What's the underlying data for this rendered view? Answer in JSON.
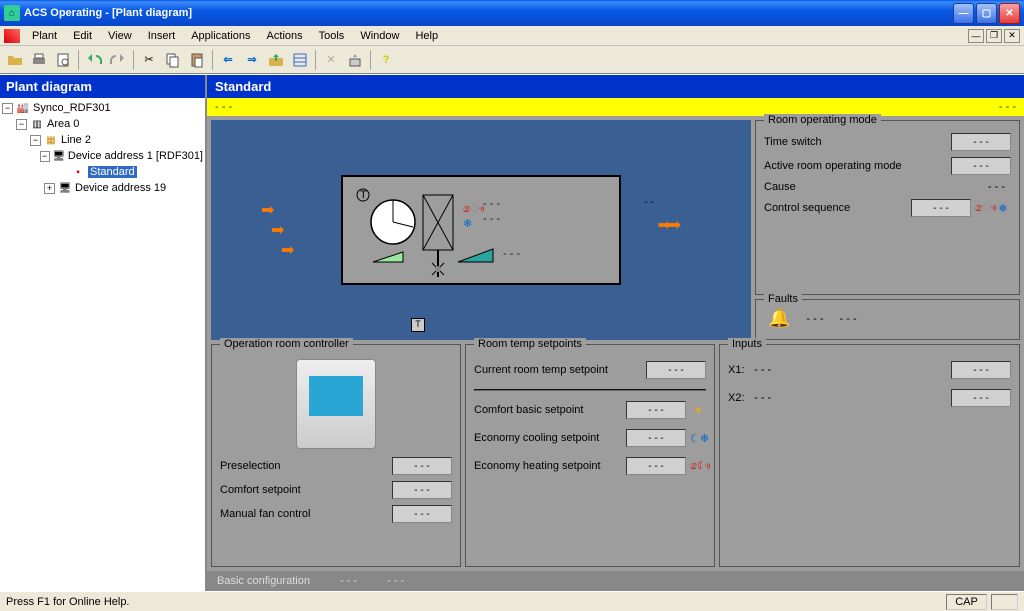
{
  "window": {
    "title": "ACS Operating - [Plant diagram]"
  },
  "menu": {
    "items": [
      "Plant",
      "Edit",
      "View",
      "Insert",
      "Applications",
      "Actions",
      "Tools",
      "Window",
      "Help"
    ]
  },
  "sidebar": {
    "title": "Plant diagram"
  },
  "tree": {
    "root": "Synco_RDF301",
    "area": "Area 0",
    "line": "Line 2",
    "dev1": "Device address 1 [RDF301]",
    "standard": "Standard",
    "dev19": "Device address 19"
  },
  "main": {
    "title": "Standard",
    "yellow_left": "- - -",
    "yellow_right": "- - -"
  },
  "room_mode": {
    "legend": "Room operating mode",
    "time_switch_label": "Time switch",
    "time_switch_val": "- - -",
    "active_label": "Active room operating mode",
    "active_val": "- - -",
    "cause_label": "Cause",
    "cause_val": "- - -",
    "ctrlseq_label": "Control sequence",
    "ctrlseq_val": "- - -"
  },
  "faults": {
    "legend": "Faults",
    "v1": "- - -",
    "v2": "- - -"
  },
  "orc": {
    "legend": "Operation room controller",
    "presel_label": "Preselection",
    "presel_val": "- - -",
    "comfort_label": "Comfort setpoint",
    "comfort_val": "- - -",
    "fan_label": "Manual fan control",
    "fan_val": "- - -"
  },
  "sp": {
    "legend": "Room temp setpoints",
    "cur_label": "Current room temp setpoint",
    "cur_val": "- - -",
    "comfort_label": "Comfort basic setpoint",
    "comfort_val": "- - -",
    "ecoc_label": "Economy cooling setpoint",
    "ecoc_val": "- - -",
    "ecoh_label": "Economy heating setpoint",
    "ecoh_val": "- - -"
  },
  "inputs": {
    "legend": "Inputs",
    "x1_label": "X1:",
    "x1_text": "- - -",
    "x1_val": "- - -",
    "x2_label": "X2:",
    "x2_text": "- - -",
    "x2_val": "- - -"
  },
  "footer": {
    "basic": "Basic configuration",
    "d1": "- - -",
    "d2": "- - -"
  },
  "status": {
    "help": "Press F1 for Online Help.",
    "cap": "CAP"
  },
  "dash": "- - -"
}
